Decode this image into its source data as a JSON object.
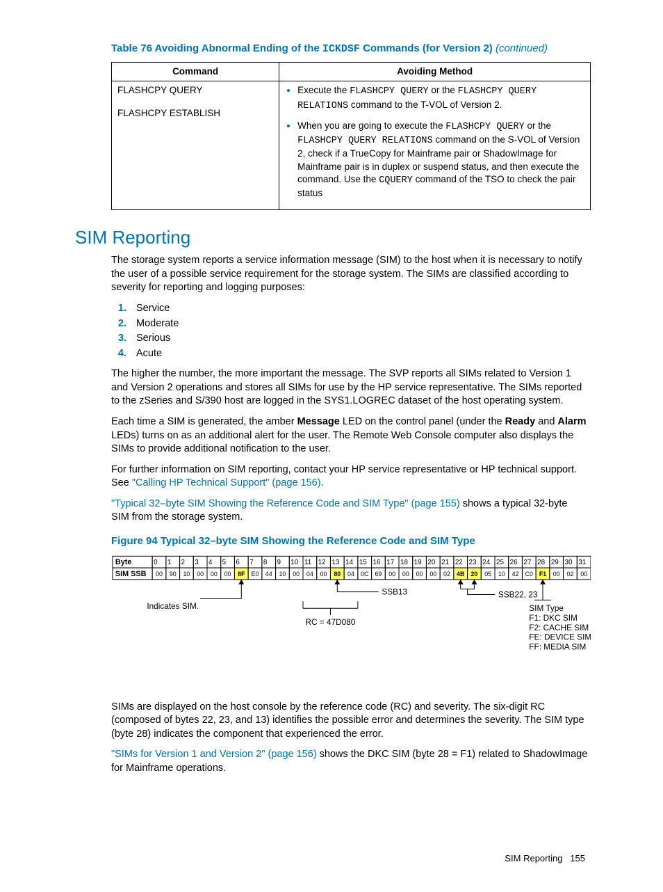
{
  "table": {
    "caption_prefix": "Table 76 Avoiding Abnormal Ending of the ",
    "caption_code": "ICKDSF",
    "caption_suffix": " Commands (for Version 2) ",
    "caption_cont": "(continued)",
    "headers": {
      "col1": "Command",
      "col2": "Avoiding Method"
    },
    "row": {
      "cmd1": "FLASHCPY QUERY",
      "cmd2": "FLASHCPY ESTABLISH",
      "b1_pre": "Execute the ",
      "b1_code1": "FLASHCPY QUERY",
      "b1_mid": " or the ",
      "b1_code2": "FLASHCPY QUERY RELATIONS",
      "b1_post": " command to the T-VOL of Version 2.",
      "b2_pre": "When you are going to execute the ",
      "b2_code1": "FLASHCPY QUERY",
      "b2_mid1": " or the ",
      "b2_code2": "FLASHCPY QUERY RELATIONS",
      "b2_mid2": " command on the S-VOL of Version 2, check if a TrueCopy for Mainframe pair or ShadowImage for Mainframe pair is in duplex or suspend status, and then execute the command. Use the ",
      "b2_code3": "CQUERY",
      "b2_post": " command of the TSO to check the pair status"
    }
  },
  "section_heading": "SIM Reporting",
  "para1": "The storage system reports a service information message (SIM) to the host when it is necessary to notify the user of a possible service requirement for the storage system. The SIMs are classified according to severity for reporting and logging purposes:",
  "severity": [
    "Service",
    "Moderate",
    "Serious",
    "Acute"
  ],
  "para2": "The higher the number, the more important the message. The SVP reports all SIMs related to Version 1 and Version 2 operations and stores all SIMs for use by the HP service representative. The SIMs reported to the zSeries and S/390 host are logged in the SYS1.LOGREC dataset of the host operating system.",
  "para3_a": "Each time a SIM is generated, the amber ",
  "para3_b": "Message",
  "para3_c": " LED on the control panel (under the ",
  "para3_d": "Ready",
  "para3_e": " and ",
  "para3_f": "Alarm",
  "para3_g": " LEDs) turns on as an additional alert for the user. The Remote Web Console computer also displays the SIMs to provide additional notification to the user.",
  "para4_a": "For further information on SIM reporting, contact your HP service representative or HP technical support. See ",
  "para4_link": "\"Calling HP Technical Support\" (page 156)",
  "para4_b": ".",
  "para5_link": "\"Typical 32–byte SIM Showing the Reference Code and SIM Type\" (page 155)",
  "para5_b": " shows a typical 32-byte SIM from the storage system.",
  "figure_caption": "Figure 94 Typical 32–byte SIM Showing the Reference Code and SIM Type",
  "para6": "SIMs are displayed on the host console by the reference code (RC) and severity. The six-digit RC (composed of bytes 22, 23, and 13) identifies the possible error and determines the severity. The SIM type (byte 28) indicates the component that experienced the error.",
  "para7_link": "\"SIMs for Version 1 and Version 2\" (page 156)",
  "para7_b": " shows the DKC SIM (byte 28 = F1) related to ShadowImage for Mainframe operations.",
  "footer_label": "SIM Reporting",
  "footer_page": "155",
  "chart_data": {
    "type": "table",
    "byte_header": "Byte",
    "ssb_header": "SIM SSB",
    "bytes": [
      "0",
      "1",
      "2",
      "3",
      "4",
      "5",
      "6",
      "7",
      "8",
      "9",
      "10",
      "11",
      "12",
      "13",
      "14",
      "15",
      "16",
      "17",
      "18",
      "19",
      "20",
      "21",
      "22",
      "23",
      "24",
      "25",
      "26",
      "27",
      "28",
      "29",
      "30",
      "31"
    ],
    "ssb": [
      "00",
      "90",
      "10",
      "00",
      "00",
      "00",
      "8F",
      "E0",
      "44",
      "10",
      "00",
      "04",
      "00",
      "80",
      "04",
      "0C",
      "69",
      "00",
      "00",
      "00",
      "00",
      "02",
      "4B",
      "20",
      "05",
      "10",
      "42",
      "C0",
      "F1",
      "00",
      "02",
      "00"
    ],
    "highlights": [
      6,
      13,
      22,
      23,
      28
    ],
    "annotations": {
      "indicates_sim": "Indicates SIM.",
      "ssb13": "SSB13",
      "ssb2223": "SSB22, 23",
      "rc": "RC = 47D080",
      "sim_type_head": "SIM Type",
      "sim_types": [
        "F1: DKC SIM",
        "F2: CACHE SIM",
        "FE: DEVICE SIM",
        "FF: MEDIA SIM"
      ]
    }
  }
}
